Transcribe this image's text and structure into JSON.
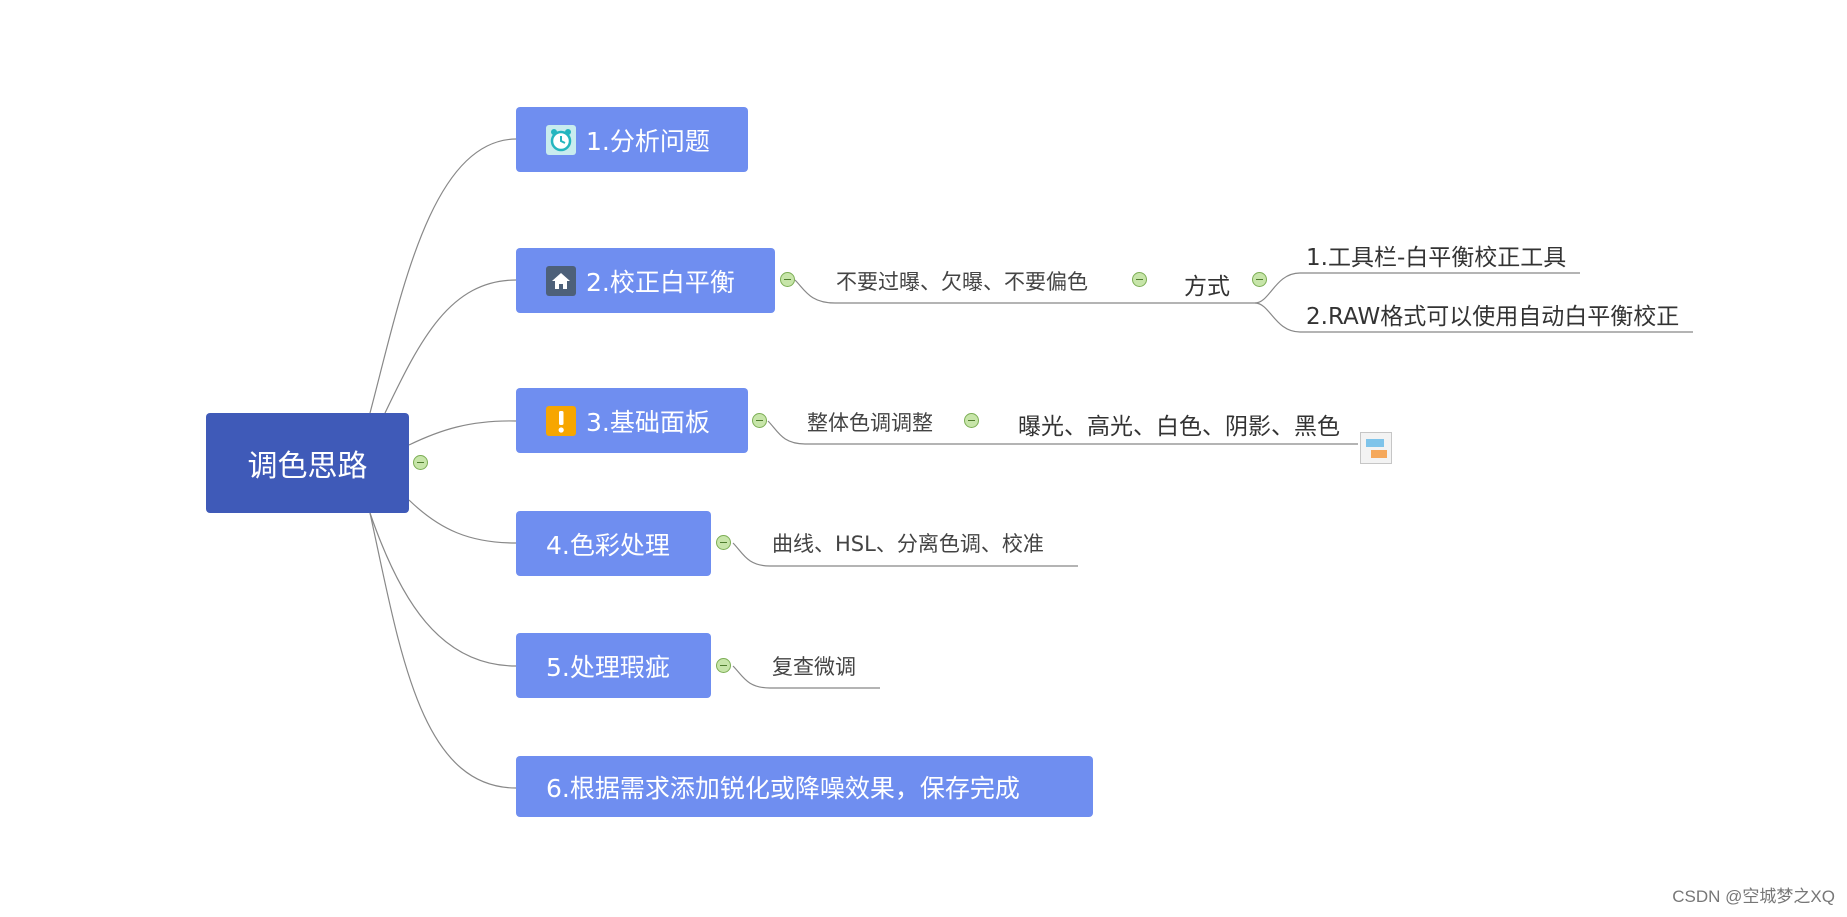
{
  "root": {
    "label": "调色思路"
  },
  "branches": [
    {
      "label": "1.分析问题",
      "icon": "alarm-clock-icon"
    },
    {
      "label": "2.校正白平衡",
      "icon": "home-icon"
    },
    {
      "label": "3.基础面板",
      "icon": "exclamation-icon"
    },
    {
      "label": "4.色彩处理"
    },
    {
      "label": "5.处理瑕疵"
    },
    {
      "label": "6.根据需求添加锐化或降噪效果，保存完成"
    }
  ],
  "b2": {
    "child": "不要过曝、欠曝、不要偏色",
    "grandchild": "方式",
    "items": [
      "1.工具栏-白平衡校正工具",
      "2.RAW格式可以使用自动白平衡校正"
    ]
  },
  "b3": {
    "child": "整体色调调整",
    "grandchild": "曝光、高光、白色、阴影、黑色"
  },
  "b4": {
    "child": "曲线、HSL、分离色调、校准"
  },
  "b5": {
    "child": "复查微调"
  },
  "watermark": "CSDN @空城梦之XQ",
  "colors": {
    "root": "#3f5ab8",
    "branch": "#6f8ef0",
    "line": "#888888"
  }
}
